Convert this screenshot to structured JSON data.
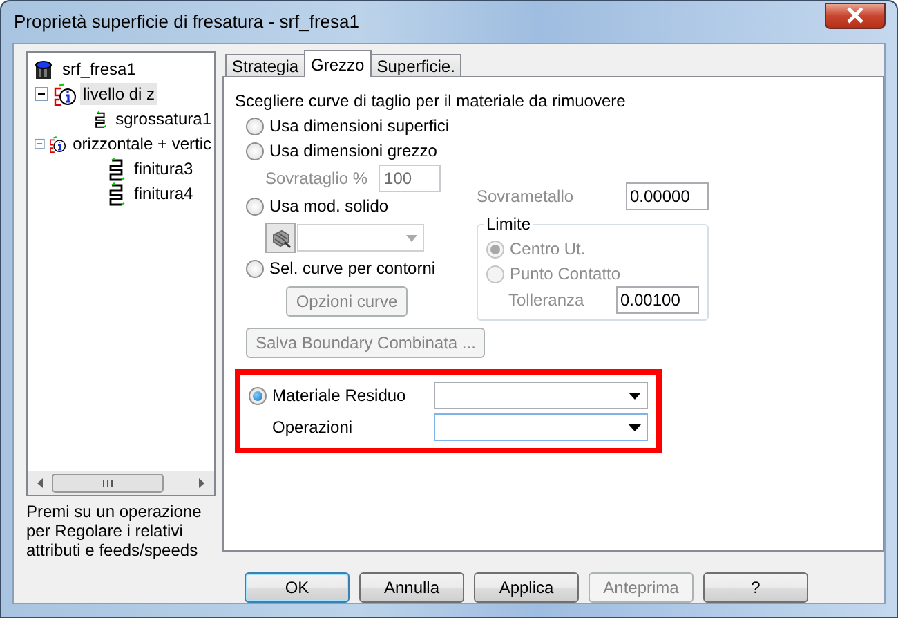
{
  "window": {
    "title": "Proprietà superficie di fresatura - srf_fresa1"
  },
  "tree": {
    "items": [
      {
        "label": "srf_fresa1",
        "kind": "root",
        "selected": false,
        "children": [
          {
            "label": "livello di z",
            "kind": "level",
            "selected": true,
            "expanded": true,
            "children": [
              {
                "label": "sgrossatura1",
                "kind": "operation",
                "selected": false
              }
            ]
          },
          {
            "label": "orizzontale + vertic",
            "kind": "level",
            "selected": false,
            "expanded": true,
            "children": [
              {
                "label": "finitura3",
                "kind": "operation",
                "selected": false
              },
              {
                "label": "finitura4",
                "kind": "operation",
                "selected": false
              }
            ]
          }
        ]
      }
    ]
  },
  "hint": "Premi su un operazione per Regolare i relativi attributi e feeds/speeds",
  "tabs": [
    {
      "label": "Strategia",
      "selected": false
    },
    {
      "label": "Grezzo",
      "selected": true
    },
    {
      "label": "Superficie.",
      "selected": false
    }
  ],
  "heading": "Scegliere curve di taglio per il materiale da rimuovere",
  "options": [
    {
      "label": "Usa dimensioni superfici",
      "selected": false,
      "disabled": false
    },
    {
      "label": "Usa dimensioni grezzo",
      "selected": false,
      "disabled": false
    },
    {
      "label": "Usa mod. solido",
      "selected": false,
      "disabled": false
    },
    {
      "label": "Sel. curve per contorni",
      "selected": false,
      "disabled": false
    }
  ],
  "sovrataglio": {
    "label": "Sovrataglio %",
    "value": "100",
    "disabled": true
  },
  "curve_options_button": {
    "label": "Opzioni curve",
    "disabled": true
  },
  "save_boundary_button": {
    "label": "Salva Boundary Combinata ...",
    "disabled": true
  },
  "sovrametallo": {
    "label": "Sovrametallo",
    "value": "0.00000"
  },
  "limite": {
    "title": "Limite",
    "options": [
      {
        "label": "Centro Ut.",
        "selected": true,
        "disabled": true
      },
      {
        "label": "Punto Contatto",
        "selected": false,
        "disabled": true
      }
    ],
    "tolleranza": {
      "label": "Tolleranza",
      "value": "0.00100"
    }
  },
  "residual": {
    "option": {
      "label": "Materiale Residuo",
      "selected": true,
      "disabled": false
    },
    "operations_label": "Operazioni"
  },
  "buttons": [
    {
      "label": "OK",
      "disabled": false,
      "default": true
    },
    {
      "label": "Annulla",
      "disabled": false,
      "default": false
    },
    {
      "label": "Applica",
      "disabled": false,
      "default": false
    },
    {
      "label": "Anteprima",
      "disabled": true,
      "default": false
    },
    {
      "label": "?",
      "disabled": false,
      "default": false
    }
  ]
}
